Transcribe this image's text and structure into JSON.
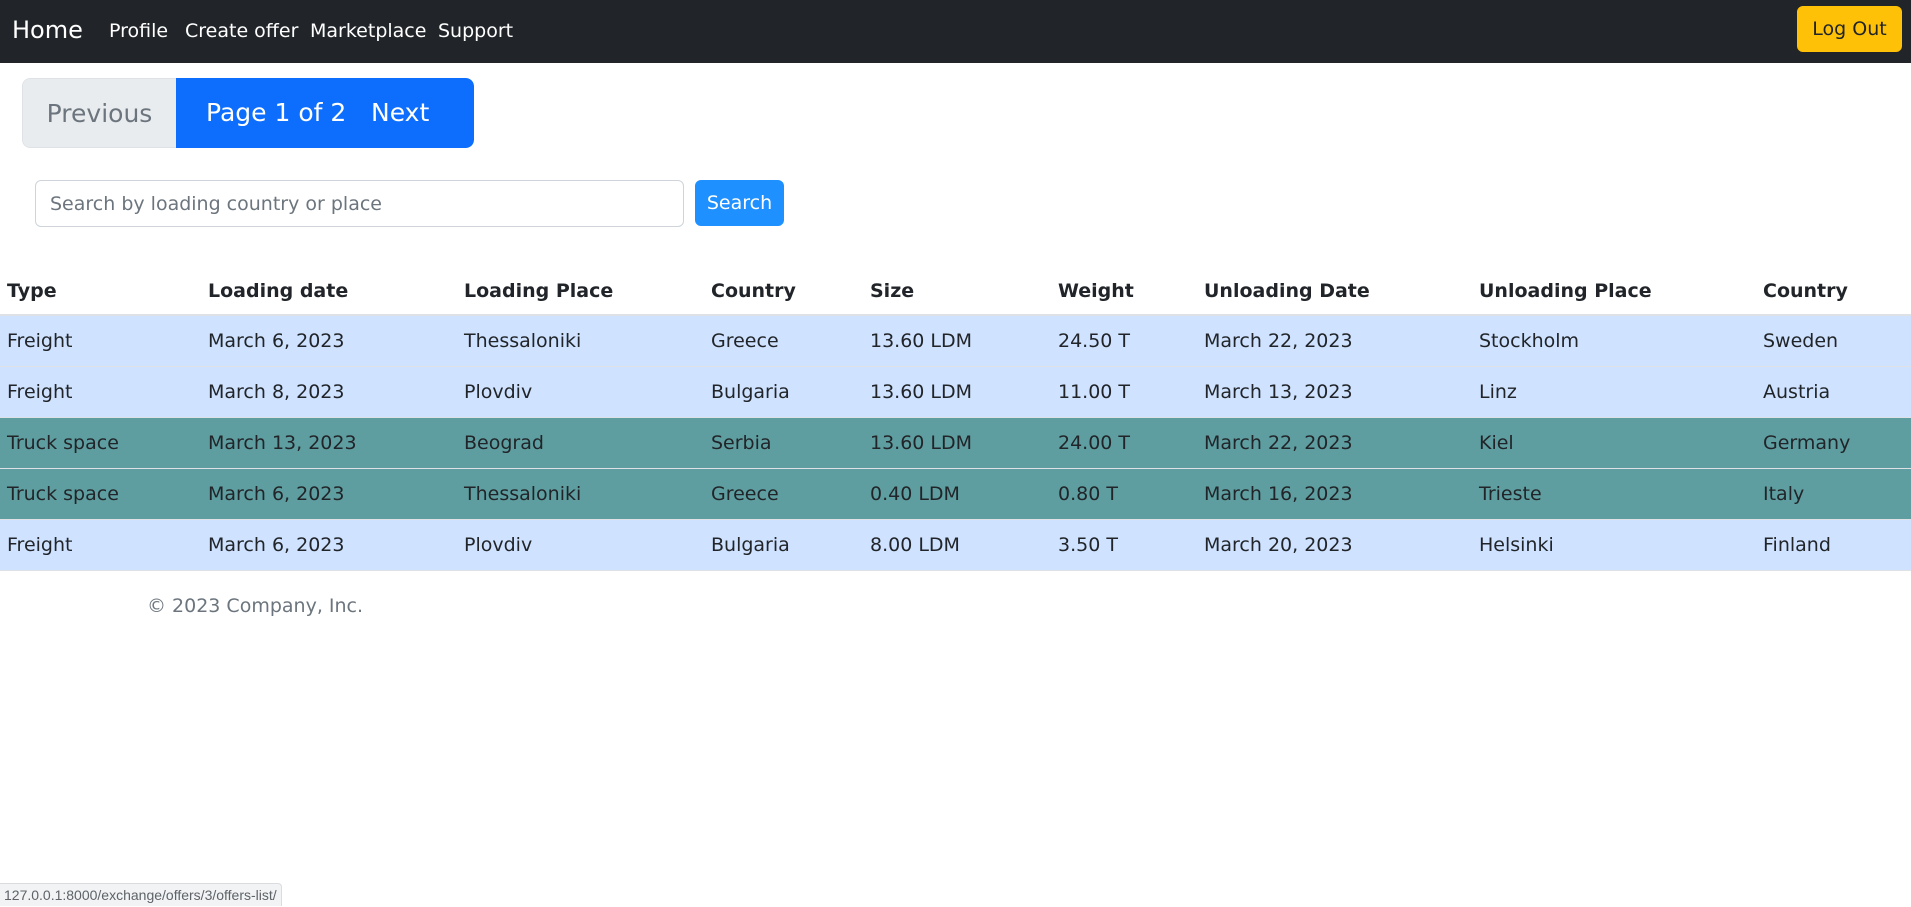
{
  "navbar": {
    "brand": "Home",
    "links": [
      "Profile",
      "Create offer",
      "Marketplace",
      "Support"
    ],
    "logout_label": "Log Out",
    "colors": {
      "background": "#212529",
      "logout": "#ffc107"
    }
  },
  "pagination": {
    "previous_label": "Previous",
    "page_info": "Page 1 of 2",
    "next_label": "Next",
    "current_page": 1,
    "total_pages": 2,
    "colors": {
      "active": "#0d6efd",
      "disabled": "#e9ecef"
    }
  },
  "search": {
    "placeholder": "Search by loading country or place",
    "value": "",
    "button_label": "Search",
    "colors": {
      "button": "#1e90ff"
    }
  },
  "table": {
    "headers": [
      "Type",
      "Loading date",
      "Loading Place",
      "Country",
      "Size",
      "Weight",
      "Unloading Date",
      "Unloading Place",
      "Country"
    ],
    "rows": [
      [
        "Freight",
        "March 6, 2023",
        "Thessaloniki",
        "Greece",
        "13.60 LDM",
        "24.50 T",
        "March 22, 2023",
        "Stockholm",
        "Sweden"
      ],
      [
        "Freight",
        "March 8, 2023",
        "Plovdiv",
        "Bulgaria",
        "13.60 LDM",
        "11.00 T",
        "March 13, 2023",
        "Linz",
        "Austria"
      ],
      [
        "Truck space",
        "March 13, 2023",
        "Beograd",
        "Serbia",
        "13.60 LDM",
        "24.00 T",
        "March 22, 2023",
        "Kiel",
        "Germany"
      ],
      [
        "Truck space",
        "March 6, 2023",
        "Thessaloniki",
        "Greece",
        "0.40 LDM",
        "0.80 T",
        "March 16, 2023",
        "Trieste",
        "Italy"
      ],
      [
        "Freight",
        "March 6, 2023",
        "Plovdiv",
        "Bulgaria",
        "8.00 LDM",
        "3.50 T",
        "March 20, 2023",
        "Helsinki",
        "Finland"
      ]
    ],
    "colors": {
      "freight_row": "#cfe2ff",
      "truck_space_row": "#5f9ea0"
    }
  },
  "footer": {
    "text": "© 2023 Company, Inc."
  },
  "status_bar": {
    "url": "127.0.0.1:8000/exchange/offers/3/offers-list/"
  }
}
